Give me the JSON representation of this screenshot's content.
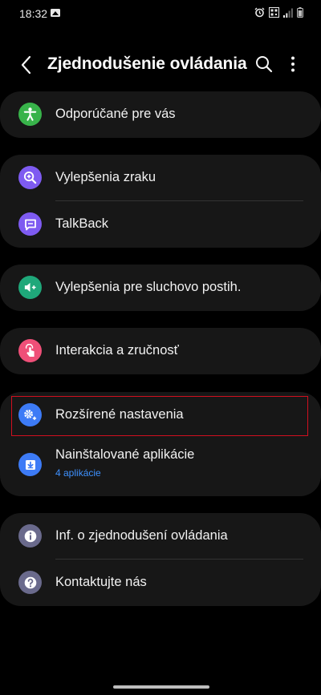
{
  "status_bar": {
    "time": "18:32"
  },
  "header": {
    "title": "Zjednodušenie ovládania"
  },
  "items": {
    "recommended": {
      "label": "Odporúčané pre vás",
      "color": "#38b34a",
      "icon": "accessibility-icon"
    },
    "vision": {
      "label": "Vylepšenia zraku",
      "color": "#7e5bf1",
      "icon": "magnifier-plus-icon"
    },
    "talkback": {
      "label": "TalkBack",
      "color": "#7e5bf1",
      "icon": "chat-bubble-icon"
    },
    "hearing": {
      "label": "Vylepšenia pre sluchovo postih.",
      "color": "#1fa87a",
      "icon": "speaker-plus-icon"
    },
    "interaction": {
      "label": "Interakcia a zručnosť",
      "color": "#ef4f78",
      "icon": "tap-finger-icon"
    },
    "advanced": {
      "label": "Rozšírené nastavenia",
      "color": "#3d7bf6",
      "icon": "gears-plus-icon"
    },
    "installed": {
      "label": "Nainštalované aplikácie",
      "sublabel": "4 aplikácie",
      "color": "#3d7bf6",
      "icon": "download-icon"
    },
    "about": {
      "label": "Inf. o zjednodušení ovládania",
      "color": "#6a6a8c",
      "icon": "info-icon"
    },
    "contact": {
      "label": "Kontaktujte nás",
      "color": "#6a6a8c",
      "icon": "question-icon"
    }
  },
  "colors": {
    "background": "#000000",
    "card": "#171717",
    "accent_link": "#3e91ff",
    "highlight": "#d10f1f"
  }
}
